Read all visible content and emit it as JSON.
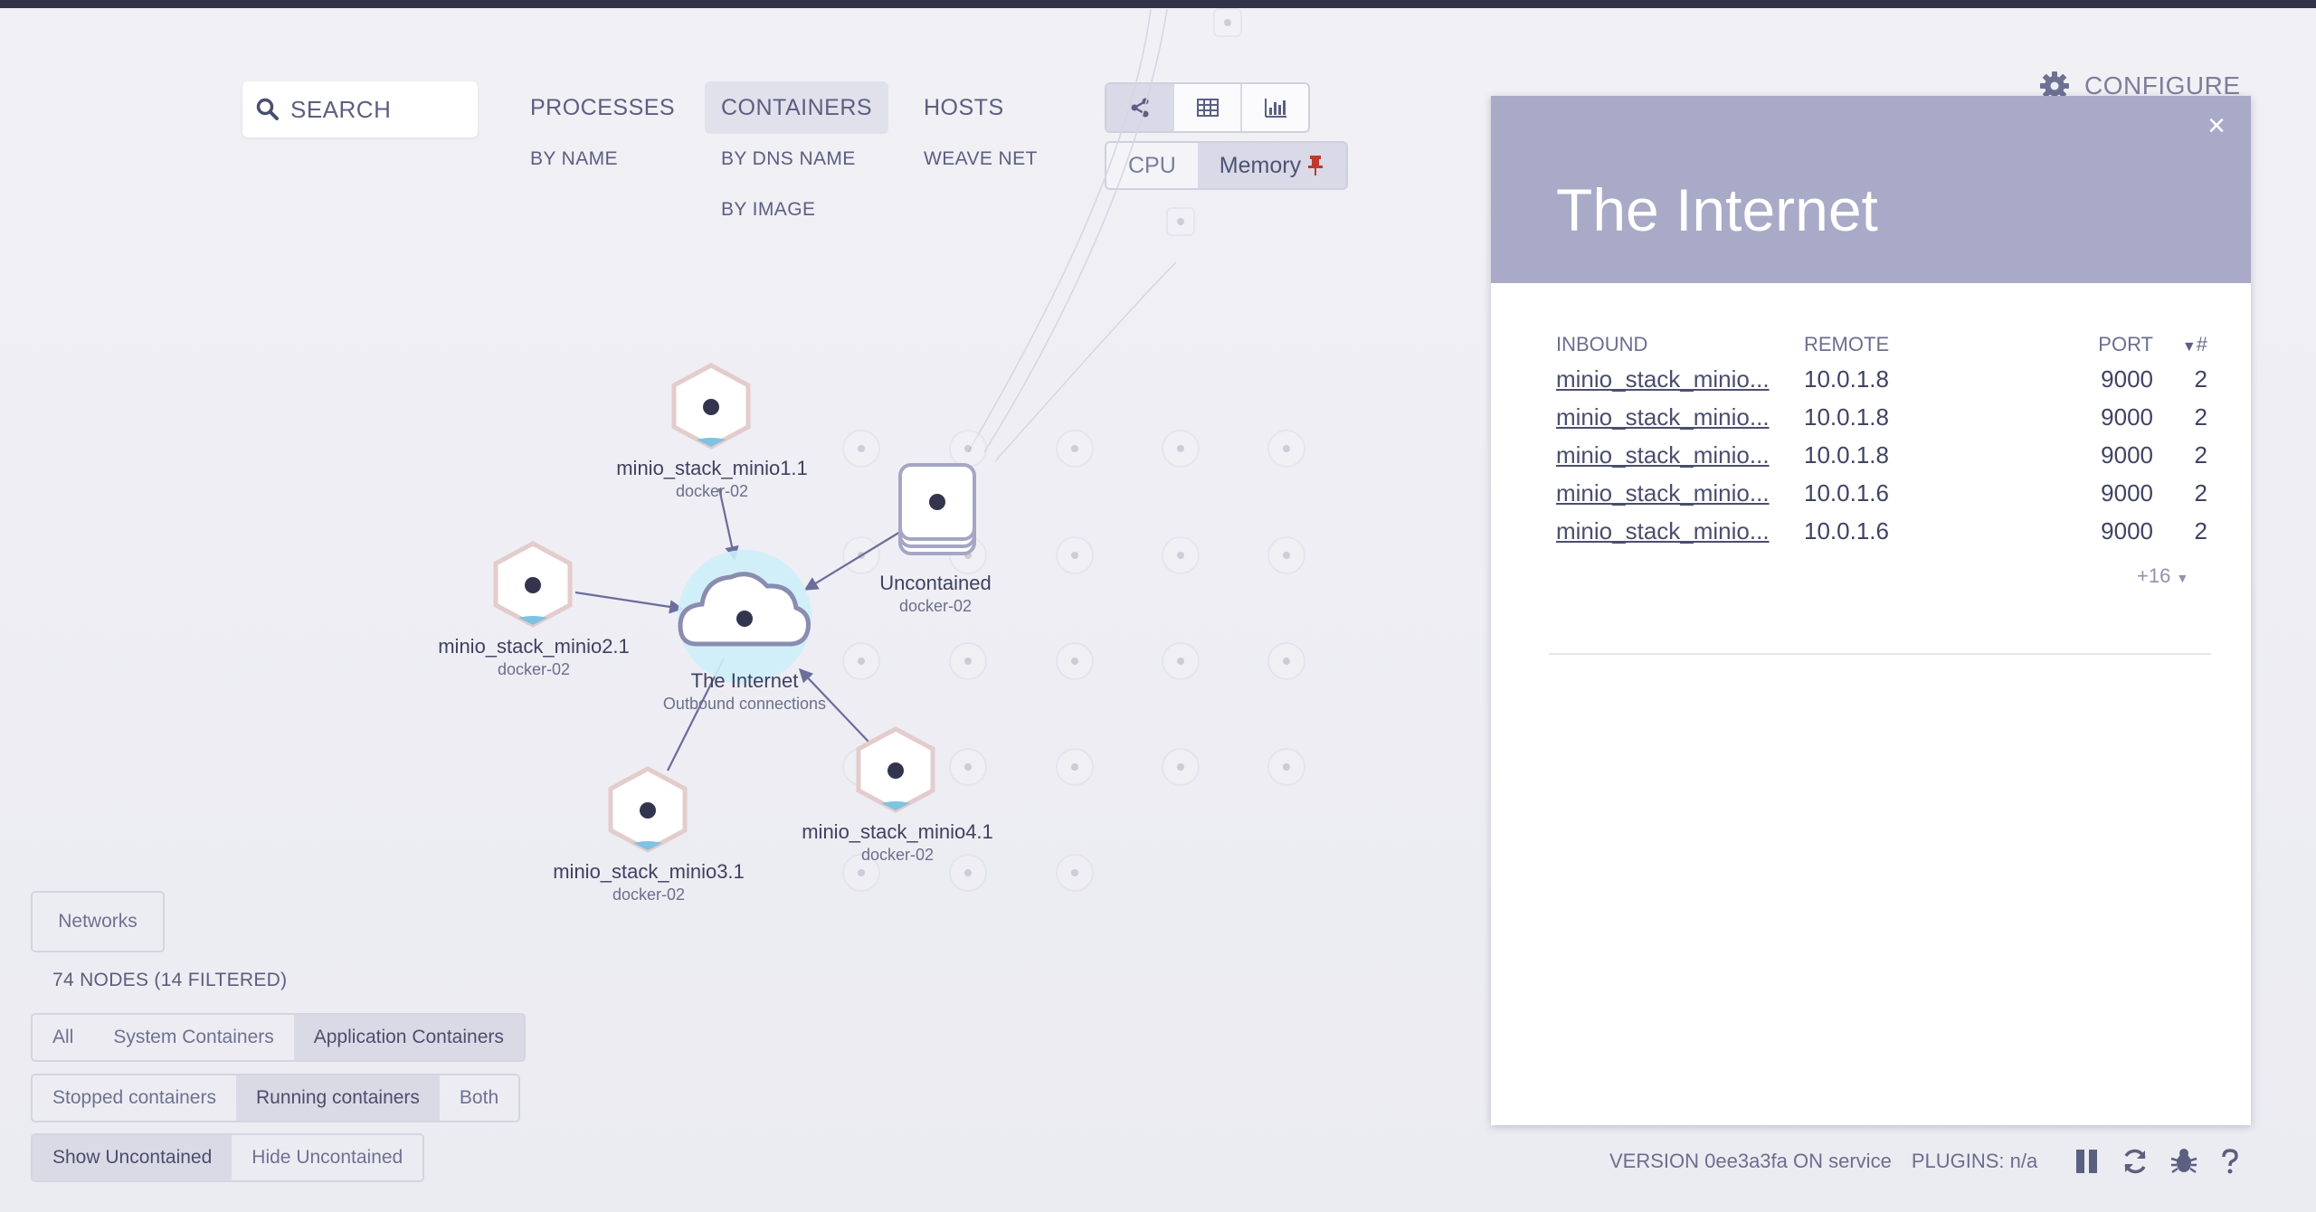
{
  "search": {
    "label": "SEARCH"
  },
  "topologies": [
    {
      "label": "PROCESSES",
      "subs": [
        "BY NAME"
      ]
    },
    {
      "label": "CONTAINERS",
      "subs": [
        "BY DNS NAME",
        "BY IMAGE"
      ]
    },
    {
      "label": "HOSTS",
      "subs": [
        "WEAVE NET"
      ]
    }
  ],
  "view_modes": [
    "graph-icon",
    "table-icon",
    "resources-icon"
  ],
  "metrics": {
    "cpu": "CPU",
    "memory": "Memory"
  },
  "configure": {
    "label": "CONFIGURE"
  },
  "nodes": [
    {
      "title": "minio_stack_minio1.1",
      "sub": "docker-02"
    },
    {
      "title": "minio_stack_minio2.1",
      "sub": "docker-02"
    },
    {
      "title": "The Internet",
      "sub": "Outbound connections"
    },
    {
      "title": "Uncontained",
      "sub": "docker-02"
    },
    {
      "title": "minio_stack_minio3.1",
      "sub": "docker-02"
    },
    {
      "title": "minio_stack_minio4.1",
      "sub": "docker-02"
    }
  ],
  "filters": {
    "networks": "Networks",
    "node_count": "74 NODES (14 FILTERED)",
    "group1": [
      "All",
      "System Containers",
      "Application Containers"
    ],
    "group2": [
      "Stopped containers",
      "Running containers",
      "Both"
    ],
    "group3": [
      "Show Uncontained",
      "Hide Uncontained"
    ]
  },
  "details": {
    "title": "The Internet",
    "close": "×",
    "columns": {
      "inbound": "INBOUND",
      "remote": "REMOTE",
      "port": "PORT",
      "count": "#"
    },
    "rows": [
      {
        "inbound": "minio_stack_minio...",
        "remote": "10.0.1.8",
        "port": "9000",
        "count": "2"
      },
      {
        "inbound": "minio_stack_minio...",
        "remote": "10.0.1.8",
        "port": "9000",
        "count": "2"
      },
      {
        "inbound": "minio_stack_minio...",
        "remote": "10.0.1.8",
        "port": "9000",
        "count": "2"
      },
      {
        "inbound": "minio_stack_minio...",
        "remote": "10.0.1.6",
        "port": "9000",
        "count": "2"
      },
      {
        "inbound": "minio_stack_minio...",
        "remote": "10.0.1.6",
        "port": "9000",
        "count": "2"
      }
    ],
    "more": "+16"
  },
  "footer": {
    "version": "VERSION 0ee3a3fa ON service",
    "plugins": "PLUGINS: n/a"
  },
  "colors": {
    "topbar": "#32324b",
    "panel_header": "#a9a9c8",
    "edge": "#6b6d9a",
    "pin": "#c0392b"
  }
}
